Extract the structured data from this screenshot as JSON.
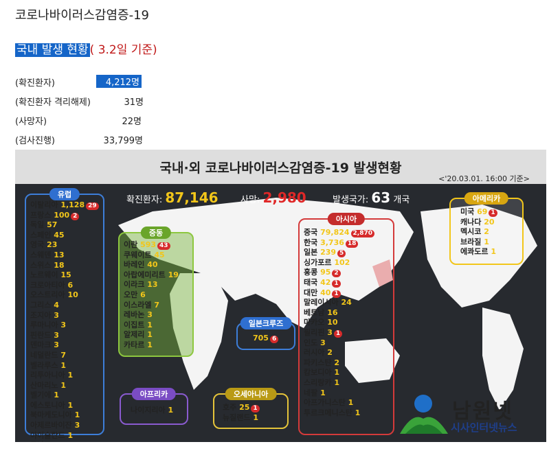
{
  "doc": {
    "title": "코로나바이러스감염증-19",
    "subtitle_highlight": "국내 발생 현황",
    "subtitle_rest": "( 3.2일 기준)"
  },
  "stats": [
    {
      "label": "(확진환자)",
      "value": "4,212명"
    },
    {
      "label": "(확진환자 격리해제)",
      "value": "31명"
    },
    {
      "label": "(사망자)",
      "value": "22명"
    },
    {
      "label": "(검사진행)",
      "value": "33,799명"
    }
  ],
  "panel": {
    "title": "국내·외 코로나바이러스감염증-19 발생현황",
    "date": "<'20.03.01. 16:00 기준>",
    "confirmed_label": "확진환자:",
    "confirmed_value": "87,146",
    "deaths_label": "사망:",
    "deaths_value": "2,980",
    "countries_label": "발생국가:",
    "countries_value": "63",
    "countries_unit": "개국"
  },
  "regions": {
    "europe": {
      "name": "유럽",
      "items": [
        [
          "이탈리아",
          "1,128",
          "29"
        ],
        [
          "프랑스",
          "100",
          "2"
        ],
        [
          "독일",
          "57",
          ""
        ],
        [
          "스페인",
          "45",
          ""
        ],
        [
          "영국",
          "23",
          ""
        ],
        [
          "스웨덴",
          "13",
          ""
        ],
        [
          "스위스",
          "18",
          ""
        ],
        [
          "노르웨이",
          "15",
          ""
        ],
        [
          "크로아티아",
          "6",
          ""
        ],
        [
          "오스트리아",
          "10",
          ""
        ],
        [
          "그리스",
          "4",
          ""
        ],
        [
          "조지아",
          "3",
          ""
        ],
        [
          "루마니아",
          "3",
          ""
        ],
        [
          "핀란드",
          "3",
          ""
        ],
        [
          "덴마크",
          "3",
          ""
        ],
        [
          "네덜란드",
          "7",
          ""
        ],
        [
          "벨라루스",
          "1",
          ""
        ],
        [
          "리투아니아",
          "1",
          ""
        ],
        [
          "산마리노",
          "1",
          ""
        ],
        [
          "벨기에",
          "1",
          ""
        ],
        [
          "에스토니아",
          "1",
          ""
        ],
        [
          "북마케도니아",
          "1",
          ""
        ],
        [
          "아제르바이잔",
          "3",
          ""
        ],
        [
          "아이슬란드",
          "1",
          ""
        ],
        [
          "모나코",
          "1",
          ""
        ]
      ]
    },
    "middle_east": {
      "name": "중동",
      "items": [
        [
          "이란",
          "593",
          "43"
        ],
        [
          "쿠웨이트",
          "45",
          ""
        ],
        [
          "바레인",
          "40",
          ""
        ],
        [
          "아랍에미리트",
          "19",
          ""
        ],
        [
          "이라크",
          "13",
          ""
        ],
        [
          "오만",
          "6",
          ""
        ],
        [
          "이스라엘",
          "7",
          ""
        ],
        [
          "레바논",
          "3",
          ""
        ],
        [
          "이집트",
          "1",
          ""
        ],
        [
          "알제리",
          "1",
          ""
        ],
        [
          "카타르",
          "1",
          ""
        ]
      ]
    },
    "africa": {
      "name": "아프리카",
      "items": [
        [
          "나이지리아",
          "1",
          ""
        ]
      ]
    },
    "cruise": {
      "name": "일본크루즈",
      "items": [
        [
          "",
          "705",
          "6"
        ]
      ]
    },
    "oceania": {
      "name": "오세아니아",
      "items": [
        [
          "호주",
          "25",
          "1"
        ],
        [
          "뉴질랜드",
          "1",
          ""
        ]
      ]
    },
    "asia": {
      "name": "아시아",
      "items": [
        [
          "중국",
          "79,824",
          "2,870"
        ],
        [
          "한국",
          "3,736",
          "18"
        ],
        [
          "일본",
          "239",
          "5"
        ],
        [
          "싱가포르",
          "102",
          ""
        ],
        [
          "홍콩",
          "95",
          "2"
        ],
        [
          "태국",
          "42",
          "1"
        ],
        [
          "대만",
          "40",
          "1"
        ],
        [
          "말레이시아",
          "24",
          ""
        ],
        [
          "베트남",
          "16",
          ""
        ],
        [
          "마카오",
          "10",
          ""
        ],
        [
          "필리핀",
          "3",
          "1"
        ],
        [
          "인도",
          "3",
          ""
        ],
        [
          "러시아",
          "2",
          ""
        ],
        [
          "파키스탄",
          "2",
          ""
        ],
        [
          "캄보디아",
          "1",
          ""
        ],
        [
          "스리랑카",
          "1",
          ""
        ],
        [
          "네팔",
          "1",
          ""
        ],
        [
          "아프가니스탄",
          "1",
          ""
        ],
        [
          "투르크메니스탄",
          "1",
          ""
        ]
      ]
    },
    "americas": {
      "name": "아메리카",
      "items": [
        [
          "미국",
          "69",
          "1"
        ],
        [
          "캐나다",
          "20",
          ""
        ],
        [
          "멕시코",
          "2",
          ""
        ],
        [
          "브라질",
          "1",
          ""
        ],
        [
          "에콰도르",
          "1",
          ""
        ]
      ]
    }
  },
  "logo": {
    "name": "남원넷",
    "tagline": "시사인터넷뉴스"
  },
  "colors": {
    "highlight": "#1565c8",
    "death_red": "#e02828",
    "number_yellow": "#f2c61a",
    "panel_bg": "#272a2f"
  }
}
